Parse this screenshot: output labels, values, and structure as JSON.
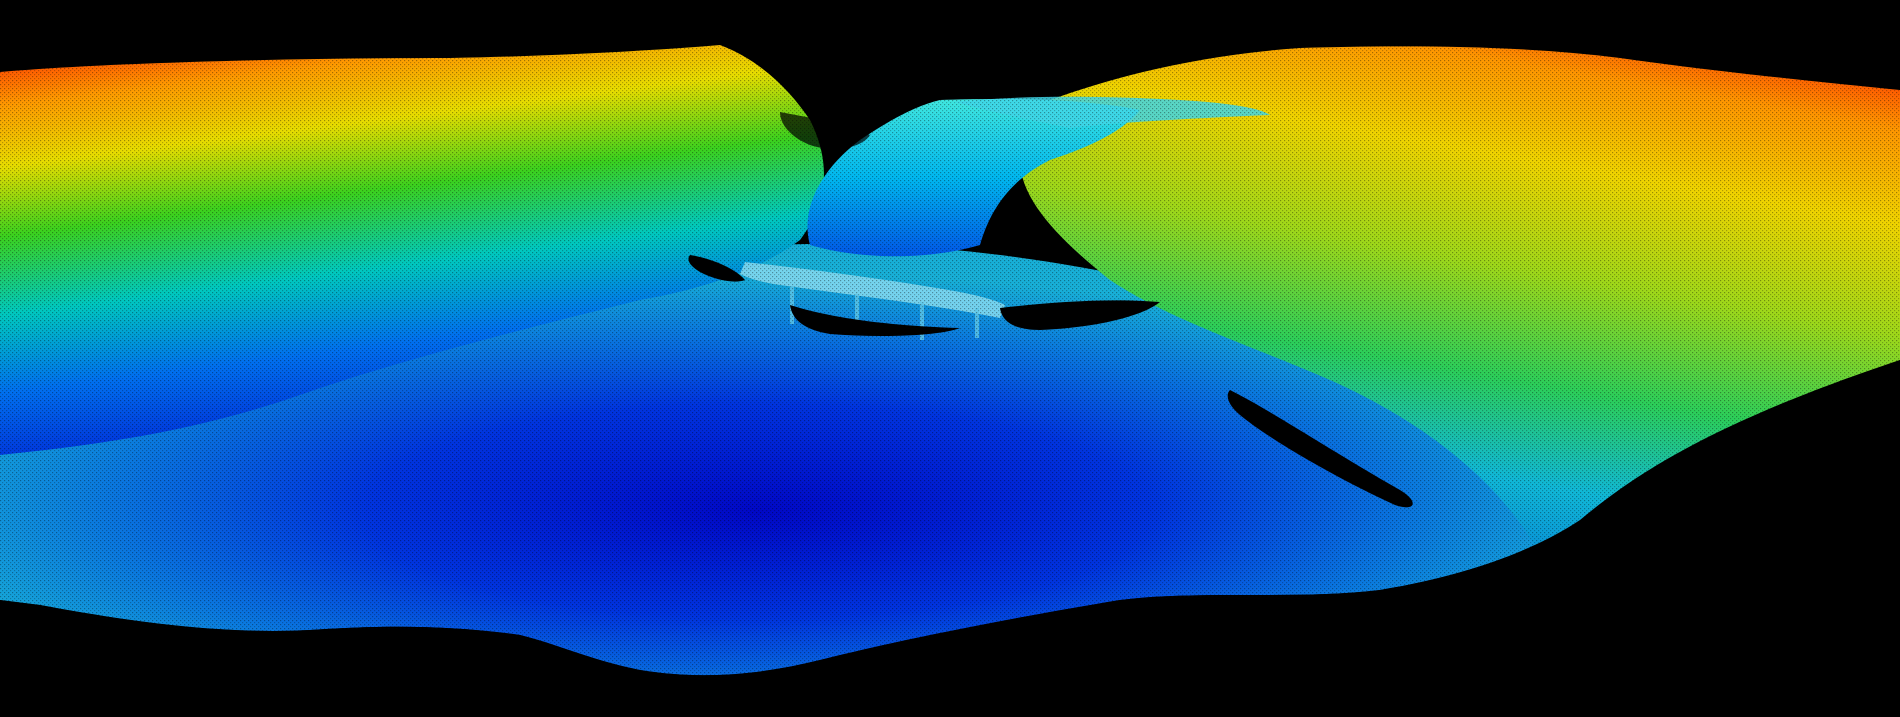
{
  "scene": {
    "kind": "bathymetric point cloud",
    "background_color": "#000000",
    "colormap": [
      "#0000ff",
      "#0070ff",
      "#00c8ff",
      "#00e6a0",
      "#20d020",
      "#c8e000",
      "#ffb000",
      "#ff3000"
    ],
    "features": [
      {
        "name": "left-slope",
        "color": "#20d020"
      },
      {
        "name": "right-slope",
        "color": "#c8e000"
      },
      {
        "name": "channel",
        "color": "#00c8ff"
      },
      {
        "name": "bridge-structure",
        "color": "#7fd8f0"
      },
      {
        "name": "basin-floor",
        "color": "#0030e0"
      },
      {
        "name": "shadow-voids",
        "color": "#000000"
      }
    ]
  }
}
